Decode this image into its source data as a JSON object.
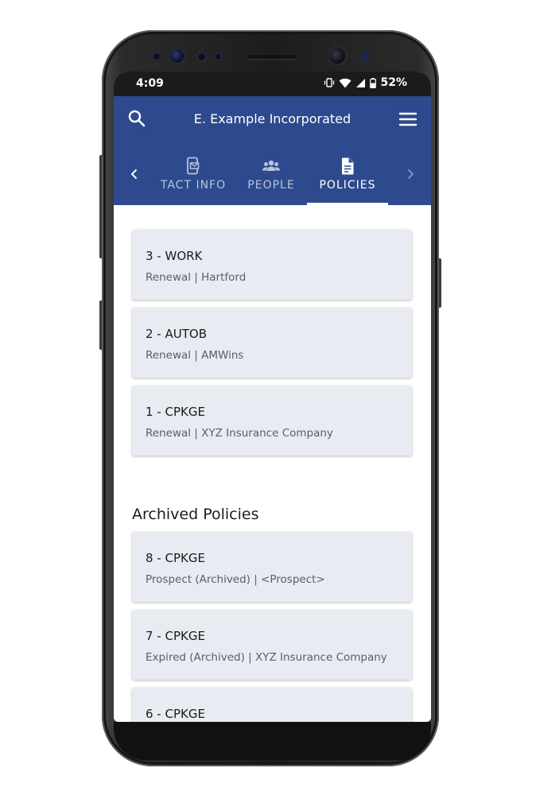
{
  "status_bar": {
    "time": "4:09",
    "battery": "52%"
  },
  "app_bar": {
    "title": "E. Example Incorporated",
    "tabs": [
      {
        "label": "TACT INFO",
        "icon": "contact-card-icon",
        "selected": false
      },
      {
        "label": "PEOPLE",
        "icon": "people-icon",
        "selected": false
      },
      {
        "label": "POLICIES",
        "icon": "document-icon",
        "selected": true
      }
    ]
  },
  "policies": [
    {
      "title": "3 - WORK",
      "subtitle": "Renewal | Hartford"
    },
    {
      "title": "2 - AUTOB",
      "subtitle": "Renewal | AMWins"
    },
    {
      "title": "1 - CPKGE",
      "subtitle": "Renewal | XYZ Insurance Company"
    }
  ],
  "archived": {
    "heading": "Archived Policies",
    "items": [
      {
        "title": "8 - CPKGE",
        "subtitle": "Prospect (Archived) | <Prospect>"
      },
      {
        "title": "7 - CPKGE",
        "subtitle": "Expired (Archived) | XYZ Insurance Company"
      },
      {
        "title": "6 - CPKGE",
        "subtitle": ""
      }
    ]
  },
  "colors": {
    "app_bar": "#2e4a8e",
    "card": "#e8ebf1",
    "status_bar": "#1b1b1b"
  }
}
